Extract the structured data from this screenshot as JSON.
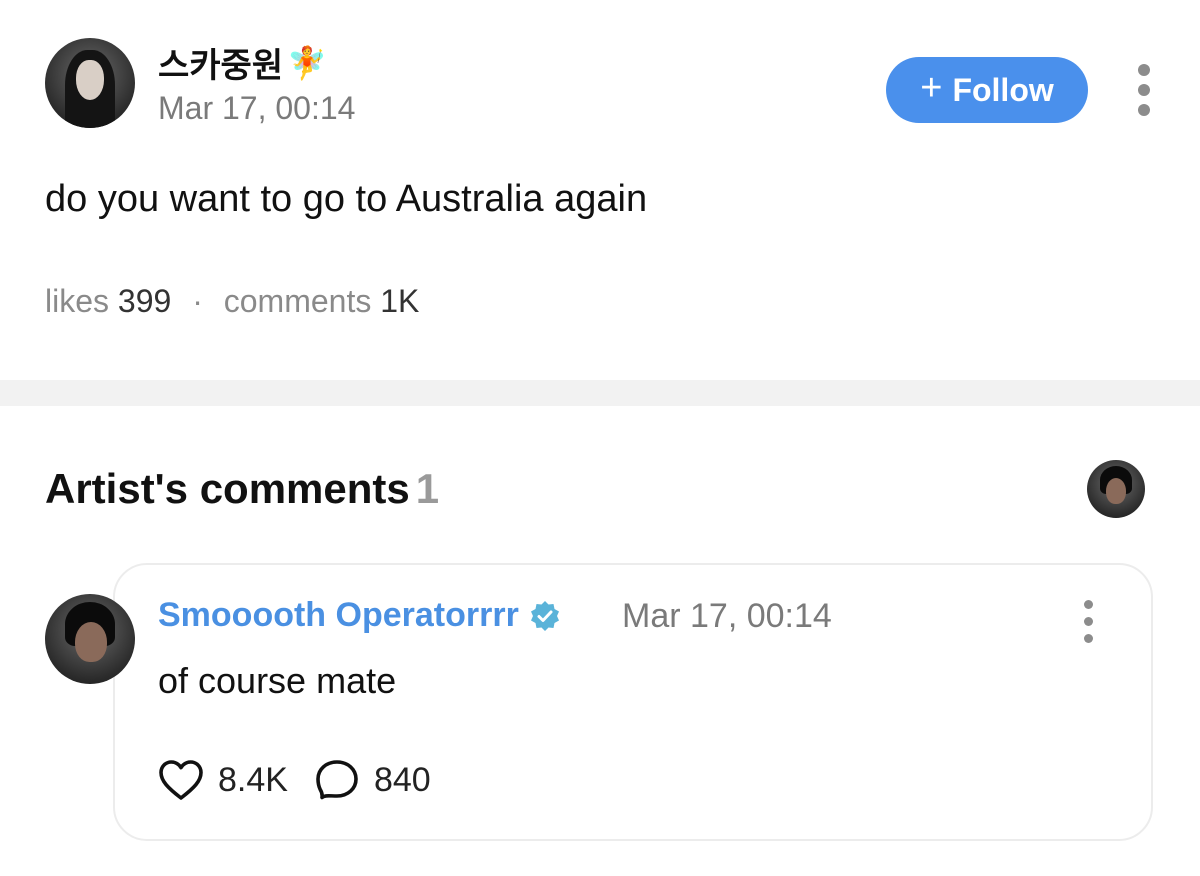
{
  "post": {
    "author": {
      "name": "스카중원",
      "badge_icon": "fairy-icon",
      "badge_glyph": "🧚"
    },
    "date": "Mar 17, 00:14",
    "follow_label": "Follow",
    "follow_plus": "+",
    "text": "do you want to go to Australia again",
    "stats": {
      "likes_label": "likes",
      "likes_value": "399",
      "separator": "·",
      "comments_label": "comments",
      "comments_value": "1K"
    }
  },
  "artist_comments": {
    "title": "Artist's comments",
    "count": "1",
    "comment": {
      "author": "Smooooth Operatorrrr",
      "verified_icon": "verified-icon",
      "date": "Mar 17, 00:14",
      "text": "of course mate",
      "likes": "8.4K",
      "replies": "840"
    }
  },
  "colors": {
    "accent": "#4a90ec",
    "commenter_name": "#4a90e2",
    "verified": "#5ab3d9",
    "muted_text": "#7a7a7a",
    "divider": "#f2f2f2"
  }
}
